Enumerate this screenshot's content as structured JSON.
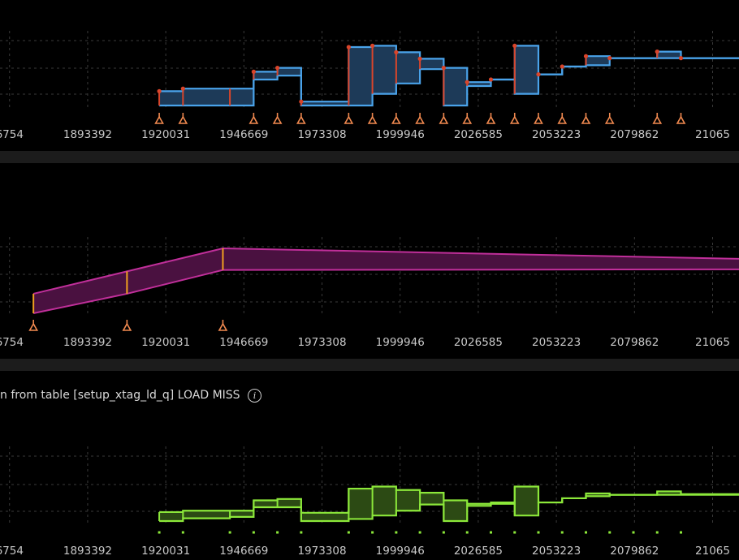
{
  "panels": [
    {
      "title": ""
    },
    {
      "title": ""
    },
    {
      "title": "n from table [setup_xtag_ld_q] LOAD MISS",
      "info_icon": "info-icon"
    }
  ],
  "colors": {
    "background": "#000000",
    "separator": "#1c1c1c",
    "grid": "#3a3a3a",
    "axis_text": "#c8c8c8",
    "blue_line": "#4aa3ea",
    "blue_fill": "#1d3a58",
    "red_marker": "#d9452b",
    "magenta_line": "#c02f9a",
    "magenta_fill": "#4a1140",
    "orange": "#f0a020",
    "green_line": "#8ce83a",
    "green_fill": "#2c4a14",
    "triangle_marker": "#f28a50"
  },
  "chart_data": [
    {
      "type": "area",
      "x_tick_labels": [
        "6754",
        "1893392",
        "1920031",
        "1946669",
        "1973308",
        "1999946",
        "2026585",
        "2053223",
        "2079862",
        "21065"
      ],
      "x_ticks": [
        1866754,
        1893392,
        1920031,
        1946669,
        1973308,
        1999946,
        2026585,
        2053223,
        2079862,
        2106501
      ],
      "x_range": [
        1863500,
        2115500
      ],
      "y_range": [
        0,
        1
      ],
      "grid": true,
      "style": "step-band",
      "series": [
        {
          "x": [
            1917800,
            1925900,
            1941900,
            1950000,
            1958100,
            1966200,
            1982400,
            1990500,
            1998600,
            2006700,
            2014800,
            2022800,
            2030900,
            2039000,
            2047100,
            2055200,
            2063300,
            2071400,
            2079500,
            2087600,
            2095700
          ],
          "upper": [
            0.22,
            0.26,
            0.26,
            0.52,
            0.58,
            0.06,
            0.9,
            0.92,
            0.82,
            0.72,
            0.58,
            0.36,
            0.4,
            0.92,
            0.48,
            0.6,
            0.76,
            0.73,
            0.73,
            0.83,
            0.73
          ],
          "lower": [
            0.0,
            0.0,
            0.0,
            0.4,
            0.46,
            0.0,
            0.0,
            0.18,
            0.34,
            0.56,
            0.0,
            0.3,
            0.4,
            0.18,
            0.48,
            0.6,
            0.62,
            0.73,
            0.73,
            0.73,
            0.73
          ],
          "markers_x": [
            1917800,
            1925900,
            1950000,
            1958100,
            1966200,
            1982400,
            1990500,
            1998600,
            2006700,
            2014800,
            2022800,
            2030900,
            2039000,
            2047100,
            2055200,
            2063300,
            2071400,
            2087600,
            2095700
          ]
        }
      ]
    },
    {
      "type": "area",
      "x_tick_labels": [
        "6754",
        "1893392",
        "1920031",
        "1946669",
        "1973308",
        "1999946",
        "2026585",
        "2053223",
        "2079862",
        "21065"
      ],
      "x_ticks": [
        1866754,
        1893392,
        1920031,
        1946669,
        1973308,
        1999946,
        2026585,
        2053223,
        2079862,
        2106501
      ],
      "x_range": [
        1863500,
        2115500
      ],
      "y_range": [
        0,
        1
      ],
      "grid": true,
      "style": "linear-band",
      "series": [
        {
          "x": [
            1874900,
            1906800,
            1939500,
            2115500
          ],
          "upper": [
            0.28,
            0.6,
            0.93,
            0.78
          ],
          "lower": [
            0.0,
            0.28,
            0.62,
            0.63
          ],
          "markers_x": [
            1874900,
            1906800,
            1939500
          ]
        }
      ]
    },
    {
      "type": "area",
      "x_tick_labels": [
        "6754",
        "1893392",
        "1920031",
        "1946669",
        "1973308",
        "1999946",
        "2026585",
        "2053223",
        "2079862",
        "21065"
      ],
      "x_ticks": [
        1866754,
        1893392,
        1920031,
        1946669,
        1973308,
        1999946,
        2026585,
        2053223,
        2079862,
        2106501
      ],
      "x_range": [
        1863500,
        2115500
      ],
      "y_range": [
        0,
        1
      ],
      "grid": true,
      "style": "step-band",
      "series": [
        {
          "x": [
            1917800,
            1925900,
            1941900,
            1950000,
            1958100,
            1966200,
            1982400,
            1990500,
            1998600,
            2006700,
            2014800,
            2022800,
            2030900,
            2039000,
            2047100,
            2055200,
            2063300,
            2071400,
            2079500,
            2087600,
            2095700
          ],
          "upper": [
            0.13,
            0.15,
            0.15,
            0.3,
            0.32,
            0.12,
            0.47,
            0.5,
            0.45,
            0.41,
            0.3,
            0.25,
            0.27,
            0.5,
            0.27,
            0.33,
            0.4,
            0.38,
            0.38,
            0.43,
            0.39
          ],
          "lower": [
            0.0,
            0.04,
            0.06,
            0.2,
            0.2,
            0.0,
            0.03,
            0.08,
            0.15,
            0.24,
            0.0,
            0.22,
            0.25,
            0.08,
            0.27,
            0.33,
            0.36,
            0.38,
            0.38,
            0.38,
            0.38
          ],
          "markers_x": [
            1917800,
            1925900,
            1941900,
            1950000,
            1958100,
            1966200,
            1982400,
            1990500,
            1998600,
            2006700,
            2014800,
            2022800,
            2030900,
            2039000,
            2047100,
            2055200,
            2063300,
            2071400,
            2079500,
            2087600,
            2095700
          ]
        }
      ]
    }
  ]
}
